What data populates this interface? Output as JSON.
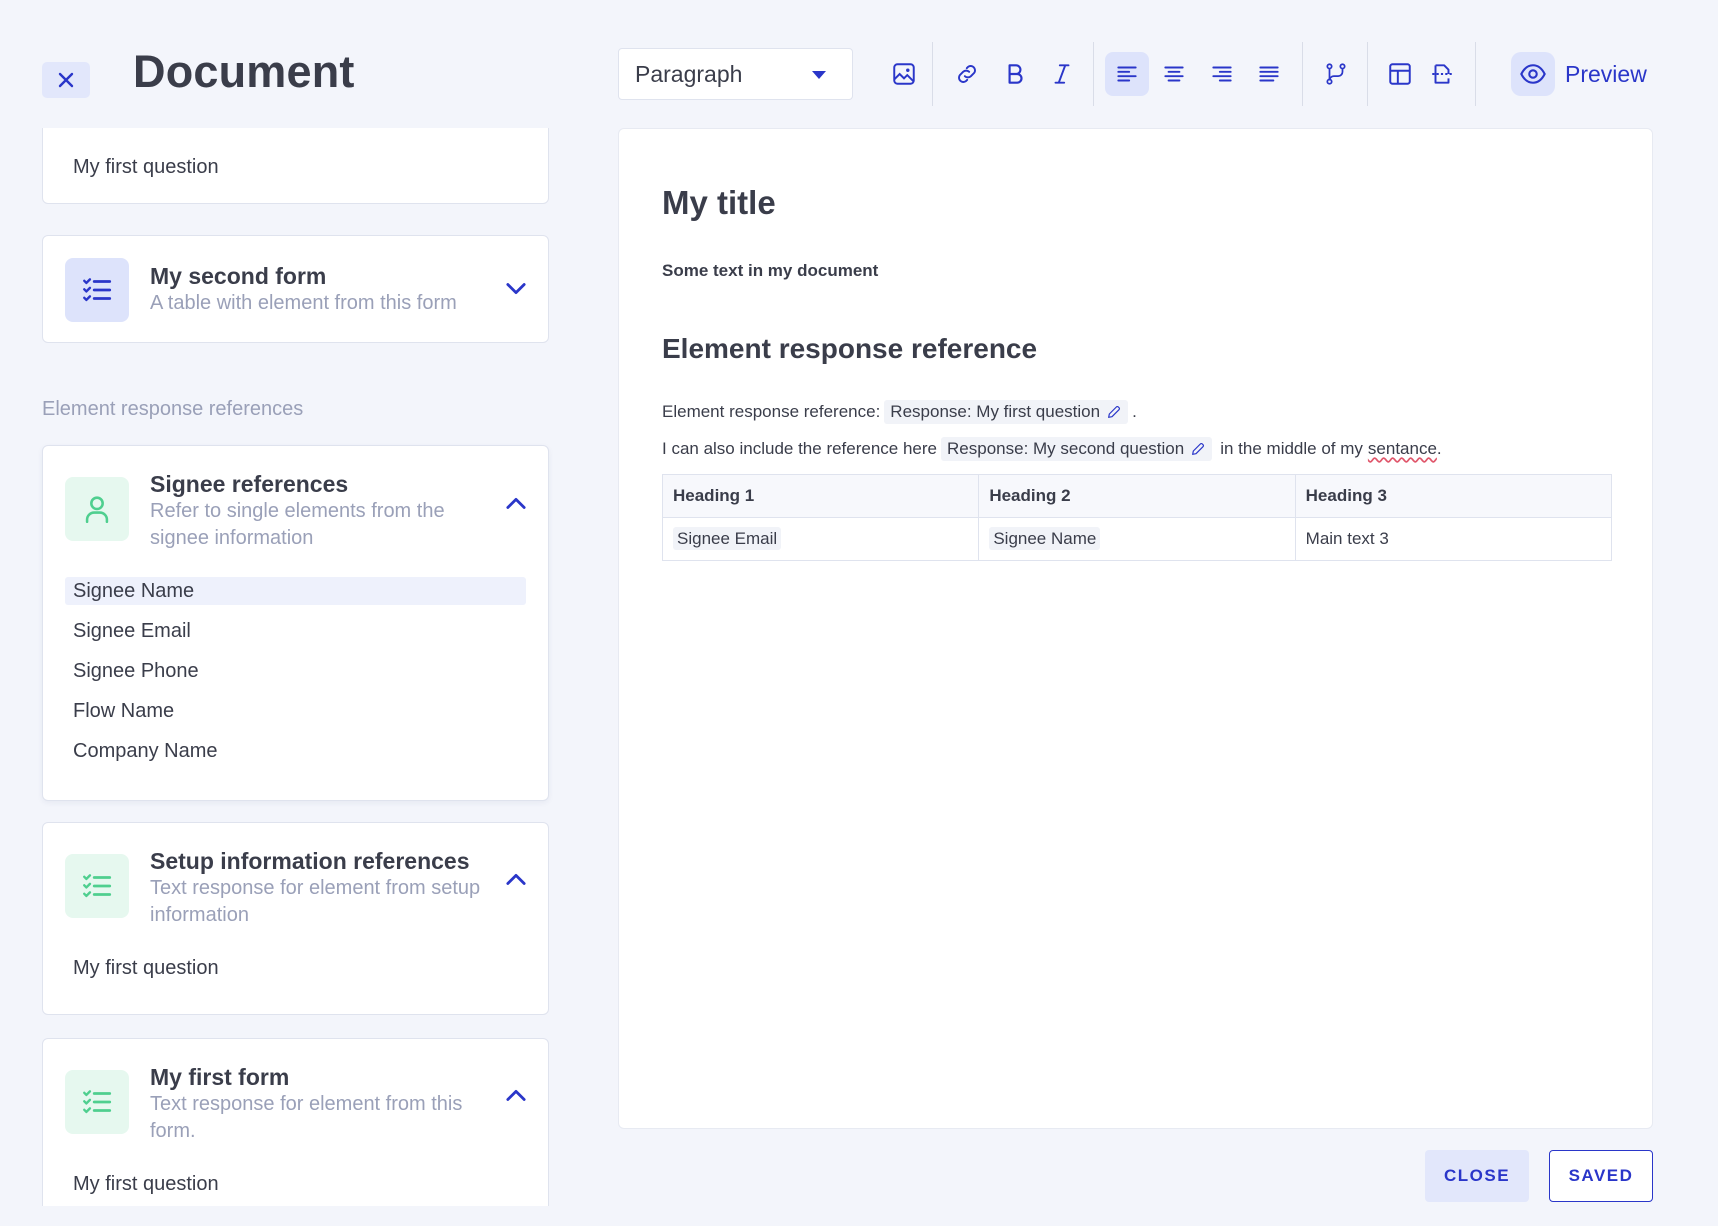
{
  "header": {
    "title": "Document",
    "close_icon": "close-icon"
  },
  "toolbar": {
    "format_value": "Paragraph",
    "buttons": [
      "image-icon",
      "link-icon",
      "bold-icon",
      "italic-icon",
      "align-left-icon",
      "align-center-icon",
      "align-right-icon",
      "align-justify-icon",
      "branch-icon",
      "table-icon",
      "reference-icon"
    ],
    "active_button": "align-left",
    "preview_label": "Preview",
    "accent": "#2a36c9"
  },
  "sidebar": {
    "top_card_item": "My first question",
    "second_form": {
      "title": "My second form",
      "subtitle": "A table with element from this form"
    },
    "section_label": "Element response references",
    "signee": {
      "title": "Signee references",
      "subtitle": "Refer to single elements from the signee information",
      "items": [
        "Signee Name",
        "Signee Email",
        "Signee Phone",
        "Flow Name",
        "Company Name"
      ]
    },
    "setup": {
      "title": "Setup information references",
      "subtitle": "Text response for element from setup information",
      "items": [
        "My first question"
      ]
    },
    "first_form": {
      "title": "My first form",
      "subtitle": "Text response for element from this form.",
      "items": [
        "My first question"
      ]
    }
  },
  "editor": {
    "title": "My title",
    "text": "Some text in my document",
    "heading": "Element response reference",
    "line1": {
      "prefix": "Element response reference:",
      "chip": "Response: My first question",
      "suffix": "."
    },
    "line2": {
      "prefix": "I can also include the reference here",
      "chip": "Response: My second question",
      "suffix_before": "in the middle of my",
      "misspelled": "sentance",
      "suffix_end": "."
    },
    "table": {
      "headers": [
        "Heading 1",
        "Heading 2",
        "Heading 3"
      ],
      "row": [
        "Signee Email",
        "Signee Name",
        "Main text 3"
      ]
    }
  },
  "footer": {
    "close_label": "CLOSE",
    "saved_label": "SAVED"
  }
}
